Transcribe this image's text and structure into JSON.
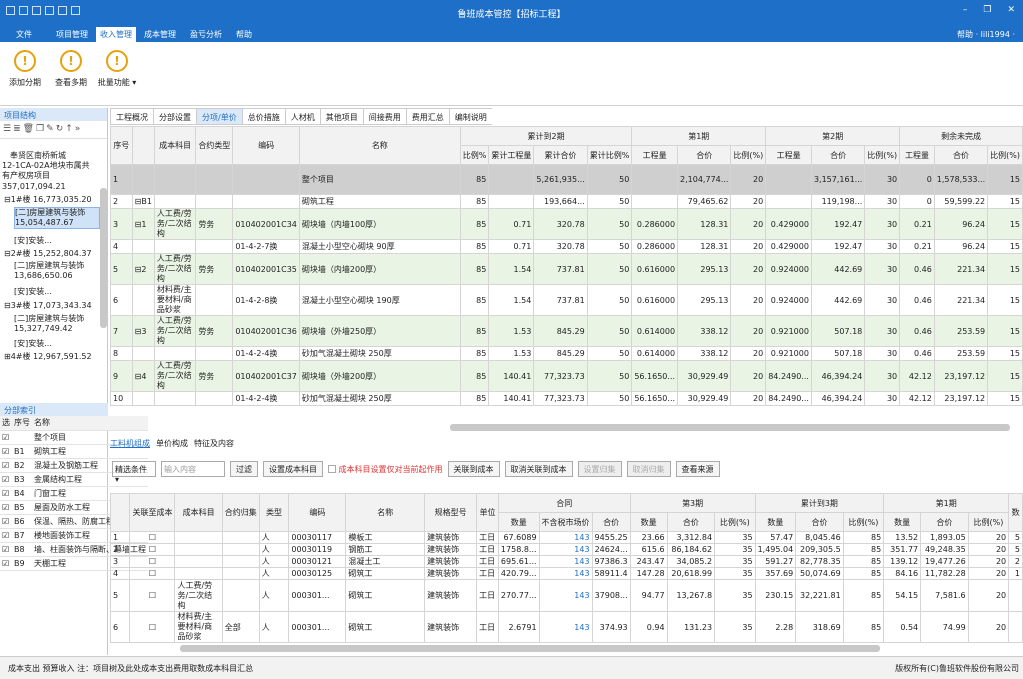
{
  "app": {
    "title": "鲁班成本管控【招标工程】",
    "user": "帮助 · lili1994 ·"
  },
  "menu": {
    "items": [
      "文件",
      "项目管理",
      "收入管理",
      "成本管理",
      "盈亏分析",
      "帮助"
    ]
  },
  "ribbon": {
    "buttons": [
      "添加分期",
      "查看多期",
      "批量功能"
    ]
  },
  "left": {
    "header": "项目结构",
    "tree": [
      "奉贤区南桥新城",
      "12-1CA-02A地块市属共",
      "有产权房项目",
      "357,017,094.21",
      "⊟1#楼 16,773,035.20",
      "[二]房屋建筑与装饰",
      "15,054,487.67",
      "[安]安装...",
      "⊟2#楼 15,252,804.37",
      "[二]房屋建筑与装饰",
      "13,686,650.06",
      "[安]安装...",
      "⊟3#楼 17,073,343.34",
      "[二]房屋建筑与装饰",
      "15,327,749.42",
      "[安]安装...",
      "⊞4#楼 12,967,591.52"
    ],
    "list_header": "分部索引",
    "list_cols": [
      "选",
      "序号",
      "名称"
    ],
    "list_rows": [
      [
        "",
        "整个项目"
      ],
      [
        "B1",
        "砌筑工程"
      ],
      [
        "B2",
        "混凝土及钢筋工程"
      ],
      [
        "B3",
        "金属结构工程"
      ],
      [
        "B4",
        "门窗工程"
      ],
      [
        "B5",
        "屋面及防水工程"
      ],
      [
        "B6",
        "保温、隔热、防腐工程"
      ],
      [
        "B7",
        "楼地面装饰工程"
      ],
      [
        "B8",
        "墙、柱面装饰与隔断、幕墙工程"
      ],
      [
        "B9",
        "天棚工程"
      ]
    ]
  },
  "tabs": [
    "工程概况",
    "分部设置",
    "分项/单价",
    "总价措施",
    "人材机",
    "其他项目",
    "间接费用",
    "费用汇总",
    "编制说明"
  ],
  "grid": {
    "headers": {
      "seq": "序号",
      "cost": "成本科目",
      "contract": "合约类型",
      "code": "编码",
      "name": "名称",
      "g1": "累计到2期",
      "g2": "第1期",
      "g3": "第2期",
      "g4": "剩余未完成"
    },
    "sub": [
      "比例%",
      "累计工程量",
      "累计合价",
      "累计比例%",
      "工程量",
      "合价",
      "比例(%)",
      "工程量",
      "合价",
      "比例(%)",
      "工程量",
      "合价",
      "比例(%)"
    ],
    "rows": [
      [
        "1",
        "",
        "",
        "",
        "",
        "整个项目",
        "85",
        "",
        "5,261,935...",
        "50",
        "",
        "2,104,774...",
        "20",
        "",
        "3,157,161...",
        "30",
        "0",
        "1,578,533...",
        "15"
      ],
      [
        "2",
        "⊟B1",
        "",
        "",
        "",
        "砌筑工程",
        "85",
        "",
        "193,664...",
        "50",
        "",
        "79,465.62",
        "20",
        "",
        "119,198...",
        "30",
        "0",
        "59,599.22",
        "15"
      ],
      [
        "3",
        "⊟1",
        "人工费/劳务/二次结构",
        "劳务",
        "010402001C34",
        "砌块墙（内墙100厚）",
        "85",
        "0.71",
        "320.78",
        "50",
        "0.286000",
        "128.31",
        "20",
        "0.429000",
        "192.47",
        "30",
        "0.21",
        "96.24",
        "15"
      ],
      [
        "4",
        "",
        "",
        "",
        "01-4-2-7换",
        "混凝土小型空心砌块 90厚",
        "85",
        "0.71",
        "320.78",
        "50",
        "0.286000",
        "128.31",
        "20",
        "0.429000",
        "192.47",
        "30",
        "0.21",
        "96.24",
        "15"
      ],
      [
        "5",
        "⊟2",
        "人工费/劳务/二次结构",
        "劳务",
        "010402001C35",
        "砌块墙（内墙200厚）",
        "85",
        "1.54",
        "737.81",
        "50",
        "0.616000",
        "295.13",
        "20",
        "0.924000",
        "442.69",
        "30",
        "0.46",
        "221.34",
        "15"
      ],
      [
        "6",
        "",
        "材料费/主要材料/商品砂浆",
        "",
        "01-4-2-8换",
        "混凝土小型空心砌块 190厚",
        "85",
        "1.54",
        "737.81",
        "50",
        "0.616000",
        "295.13",
        "20",
        "0.924000",
        "442.69",
        "30",
        "0.46",
        "221.34",
        "15"
      ],
      [
        "7",
        "⊟3",
        "人工费/劳务/二次结构",
        "劳务",
        "010402001C36",
        "砌块墙（外墙250厚）",
        "85",
        "1.53",
        "845.29",
        "50",
        "0.614000",
        "338.12",
        "20",
        "0.921000",
        "507.18",
        "30",
        "0.46",
        "253.59",
        "15"
      ],
      [
        "8",
        "",
        "",
        "",
        "01-4-2-4换",
        "砂加气混凝土砌块 250厚",
        "85",
        "1.53",
        "845.29",
        "50",
        "0.614000",
        "338.12",
        "20",
        "0.921000",
        "507.18",
        "30",
        "0.46",
        "253.59",
        "15"
      ],
      [
        "9",
        "⊟4",
        "人工费/劳务/二次结构",
        "劳务",
        "010402001C37",
        "砌块墙（外墙200厚）",
        "85",
        "140.41",
        "77,323.73",
        "50",
        "56.1650...",
        "30,929.49",
        "20",
        "84.2490...",
        "46,394.24",
        "30",
        "42.12",
        "23,197.12",
        "15"
      ],
      [
        "10",
        "",
        "",
        "",
        "01-4-2-4换",
        "砂加气混凝土砌块 250厚",
        "85",
        "140.41",
        "77,323.73",
        "50",
        "56.1650...",
        "30,929.49",
        "20",
        "84.2490...",
        "46,394.24",
        "30",
        "42.12",
        "23,197.12",
        "15"
      ]
    ]
  },
  "bottom_tabs": [
    "工料机组成",
    "单价构成",
    "特征及内容"
  ],
  "filter": {
    "select": "精选条件",
    "placeholder": "输入内容",
    "buttons": [
      "过滤",
      "设置成本科目",
      "关联到成本",
      "取消关联到成本",
      "设置归集",
      "取消归集",
      "查看来源"
    ],
    "warning": "成本科目设置仅对当前起作用"
  },
  "bgrid": {
    "headers": {
      "link": "关联至成本",
      "cost": "成本科目",
      "contract": "合约归集",
      "type": "类型",
      "code": "编码",
      "name": "名称",
      "spec": "规格型号",
      "unit": "单位",
      "g1": "合同",
      "g2": "第3期",
      "g3": "累计到3期",
      "g4": "第1期",
      "g5": "数"
    },
    "sub": [
      "数量",
      "不含税市场价",
      "合价",
      "数量",
      "合价",
      "比例(%)",
      "数量",
      "合价",
      "比例(%)",
      "数量",
      "合价",
      "比例(%)"
    ],
    "rows": [
      [
        "1",
        "",
        "",
        "",
        "人",
        "00030117",
        "模板工",
        "建筑装饰",
        "工日",
        "67.6089",
        "143",
        "9455.25",
        "23.66",
        "3,312.84",
        "35",
        "57.47",
        "8,045.46",
        "85",
        "13.52",
        "1,893.05",
        "20",
        "5"
      ],
      [
        "2",
        "",
        "",
        "",
        "人",
        "00030119",
        "钢筋工",
        "建筑装饰",
        "工日",
        "1758.8...",
        "143",
        "24624...",
        "615.6",
        "86,184.62",
        "35",
        "1,495.04",
        "209,305.5",
        "85",
        "351.77",
        "49,248.35",
        "20",
        "5"
      ],
      [
        "3",
        "",
        "",
        "",
        "人",
        "00030121",
        "混凝土工",
        "建筑装饰",
        "工日",
        "695.61...",
        "143",
        "97386.3",
        "243.47",
        "34,085.2",
        "35",
        "591.27",
        "82,778.35",
        "85",
        "139.12",
        "19,477.26",
        "20",
        "2"
      ],
      [
        "4",
        "",
        "",
        "",
        "人",
        "00030125",
        "砌筑工",
        "建筑装饰",
        "工日",
        "420.79...",
        "143",
        "58911.4",
        "147.28",
        "20,618.99",
        "35",
        "357.69",
        "50,074.69",
        "85",
        "84.16",
        "11,782.28",
        "20",
        "1"
      ],
      [
        "5",
        "",
        "人工费/劳务/二次结构",
        "",
        "人",
        "000301...",
        "砌筑工",
        "建筑装饰",
        "工日",
        "270.77...",
        "143",
        "37908...",
        "94.77",
        "13,267.8",
        "35",
        "230.15",
        "32,221.81",
        "85",
        "54.15",
        "7,581.6",
        "20",
        ""
      ],
      [
        "6",
        "",
        "材料费/主要材料/商品砂浆",
        "全部",
        "人",
        "000301...",
        "砌筑工",
        "建筑装饰",
        "工日",
        "2.6791",
        "143",
        "374.93",
        "0.94",
        "131.23",
        "35",
        "2.28",
        "318.69",
        "85",
        "0.54",
        "74.99",
        "20",
        ""
      ]
    ]
  },
  "status": {
    "left": "成本支出    预算收入    注：项目树及此处成本支出费用取数成本科目汇总",
    "right": "版权所有(C)鲁班软件股份有限公司"
  }
}
